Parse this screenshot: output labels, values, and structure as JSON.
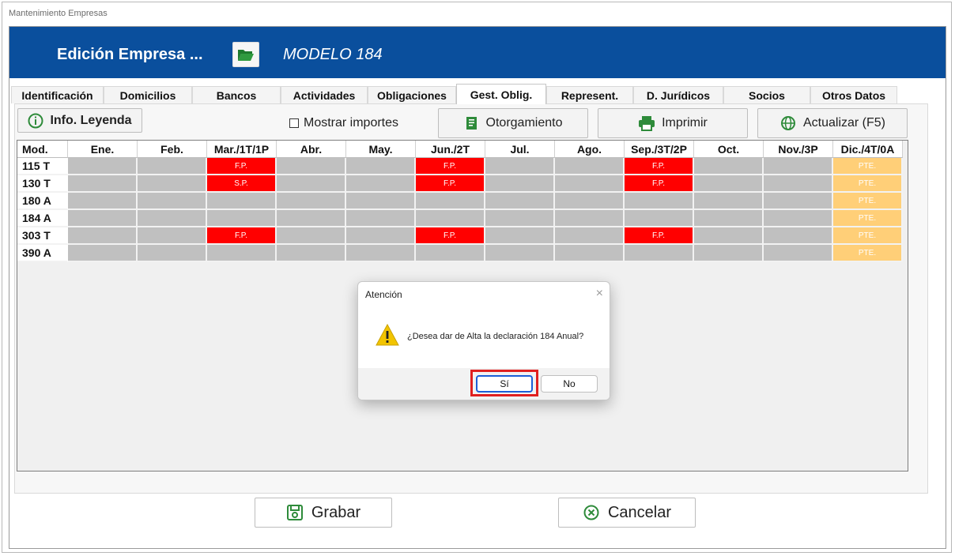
{
  "window": {
    "title": "Mantenimiento Empresas"
  },
  "header": {
    "title": "Edición Empresa ...",
    "model": "MODELO 184",
    "folder_icon": "folder-open-icon"
  },
  "tabs": [
    {
      "label": "Identificación"
    },
    {
      "label": "Domicilios"
    },
    {
      "label": "Bancos"
    },
    {
      "label": "Actividades"
    },
    {
      "label": "Obligaciones"
    },
    {
      "label": "Gest. Oblig.",
      "active": true
    },
    {
      "label": "Represent."
    },
    {
      "label": "D. Jurídicos"
    },
    {
      "label": "Socios"
    },
    {
      "label": "Otros Datos"
    }
  ],
  "toolbar": {
    "info_label": "Info. Leyenda",
    "show_amounts_label": "Mostrar importes",
    "show_amounts_checked": false,
    "grant_label": "Otorgamiento",
    "print_label": "Imprimir",
    "refresh_label": "Actualizar (F5)"
  },
  "grid": {
    "headers": [
      "Mod.",
      "Ene.",
      "Feb.",
      "Mar./1T/1P",
      "Abr.",
      "May.",
      "Jun./2T",
      "Jul.",
      "Ago.",
      "Sep./3T/2P",
      "Oct.",
      "Nov./3P",
      "Dic./4T/0A"
    ],
    "rows": [
      {
        "mod": "115 T",
        "cells": [
          "",
          "",
          "F.P.",
          "",
          "",
          "F.P.",
          "",
          "",
          "F.P.",
          "",
          "",
          "PTE."
        ]
      },
      {
        "mod": "130 T",
        "cells": [
          "",
          "",
          "S.P.",
          "",
          "",
          "F.P.",
          "",
          "",
          "F.P.",
          "",
          "",
          "PTE."
        ]
      },
      {
        "mod": "180 A",
        "cells": [
          "",
          "",
          "",
          "",
          "",
          "",
          "",
          "",
          "",
          "",
          "",
          "PTE."
        ]
      },
      {
        "mod": "184 A",
        "cells": [
          "",
          "",
          "",
          "",
          "",
          "",
          "",
          "",
          "",
          "",
          "",
          "PTE."
        ]
      },
      {
        "mod": "303 T",
        "cells": [
          "",
          "",
          "F.P.",
          "",
          "",
          "F.P.",
          "",
          "",
          "F.P.",
          "",
          "",
          "PTE."
        ]
      },
      {
        "mod": "390 A",
        "cells": [
          "",
          "",
          "",
          "",
          "",
          "",
          "",
          "",
          "",
          "",
          "",
          "PTE."
        ]
      }
    ],
    "colors": {
      "empty": "#c0c0c0",
      "red": "#ff0000",
      "pending": "#ffcf78"
    }
  },
  "bottom": {
    "save_label": "Grabar",
    "cancel_label": "Cancelar"
  },
  "dialog": {
    "title": "Atención",
    "message": "¿Desea dar de Alta la declaración 184 Anual?",
    "yes_label": "Sí",
    "no_label": "No",
    "icon": "warning-icon"
  }
}
